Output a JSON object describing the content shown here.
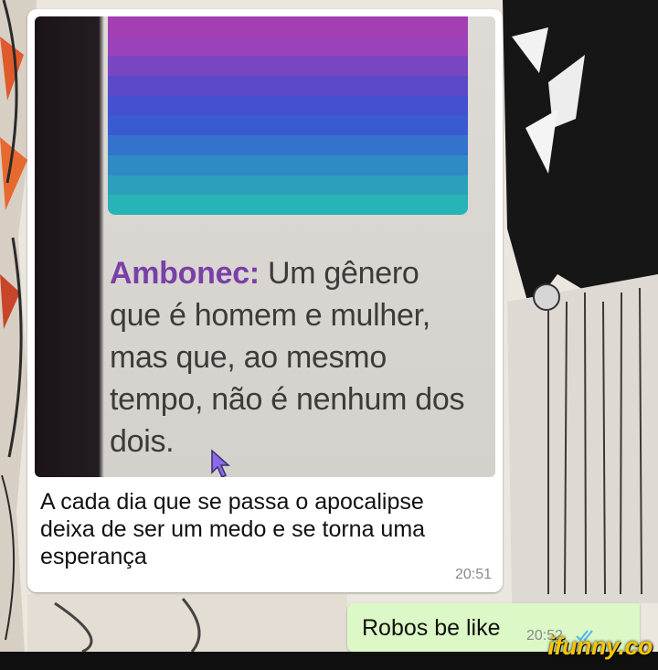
{
  "screenshot_text": {
    "term": "Ambonec:",
    "definition": " Um gênero que é homem e mulher, mas que, ao mesmo tempo, não é nenhum dos dois."
  },
  "flag_colors": [
    "#a43fb3",
    "#9b42ba",
    "#7a45c0",
    "#5a4ac9",
    "#4350cf",
    "#385bd1",
    "#3473cc",
    "#2f8ac5",
    "#2ba0bd",
    "#28b3b6"
  ],
  "incoming": {
    "text": "A cada dia que se passa o apocalipse deixa de ser um medo e se torna uma esperança",
    "time": "20:51"
  },
  "outgoing": {
    "text": "Robos be like",
    "time": "20:52",
    "status_icon": "double-check-icon"
  },
  "watermark": "ifunny.co",
  "colors": {
    "outgoing_bubble": "#dcf8c6",
    "incoming_bubble": "#ffffff",
    "read_check": "#4fb6ec",
    "watermark": "#f5c400"
  }
}
